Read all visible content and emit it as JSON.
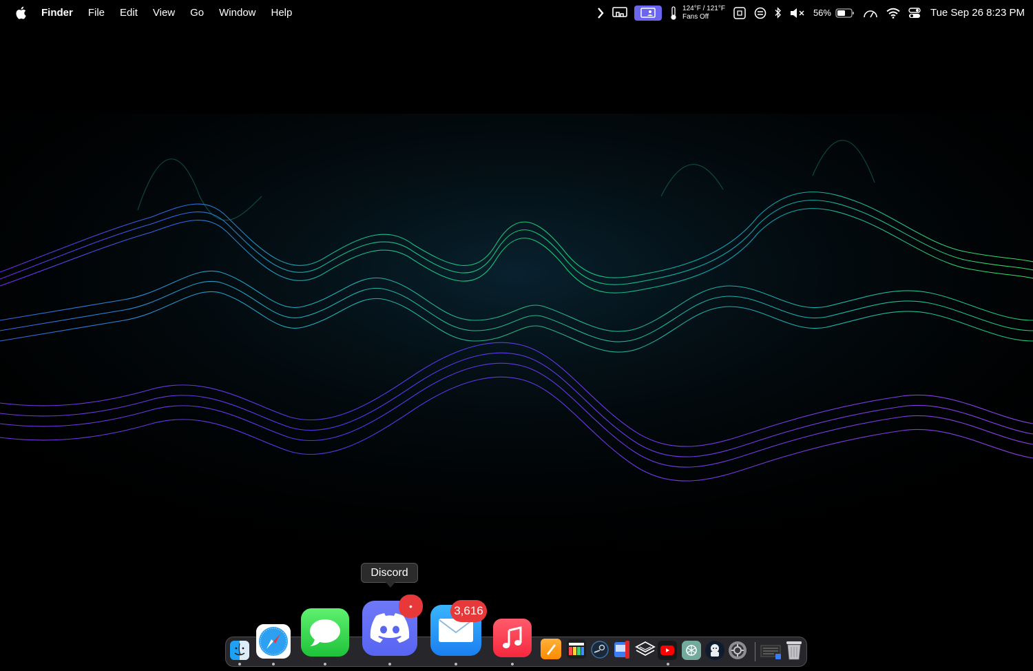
{
  "menubar": {
    "app_name": "Finder",
    "menus": [
      "File",
      "Edit",
      "View",
      "Go",
      "Window",
      "Help"
    ],
    "temperature": "124°F / 121°F",
    "fans": "Fans Off",
    "battery_percent": "56%",
    "clock": "Tue Sep 26  8:23 PM",
    "stage_color": "#6b66f0"
  },
  "dock": {
    "tooltip": "Discord",
    "discord_badge": "•",
    "mail_badge": "3,616",
    "badge_color": "#e8393a",
    "icons": [
      "finder-icon",
      "safari-icon",
      "messages-icon",
      "discord-icon",
      "mail-icon",
      "music-icon",
      "pages-icon",
      "final-cut-icon",
      "steam-icon",
      "app-icon",
      "layers-icon",
      "youtube-icon",
      "chatgpt-icon",
      "assistant-icon",
      "settings-icon",
      "downloads-stack-icon",
      "trash-icon"
    ]
  }
}
